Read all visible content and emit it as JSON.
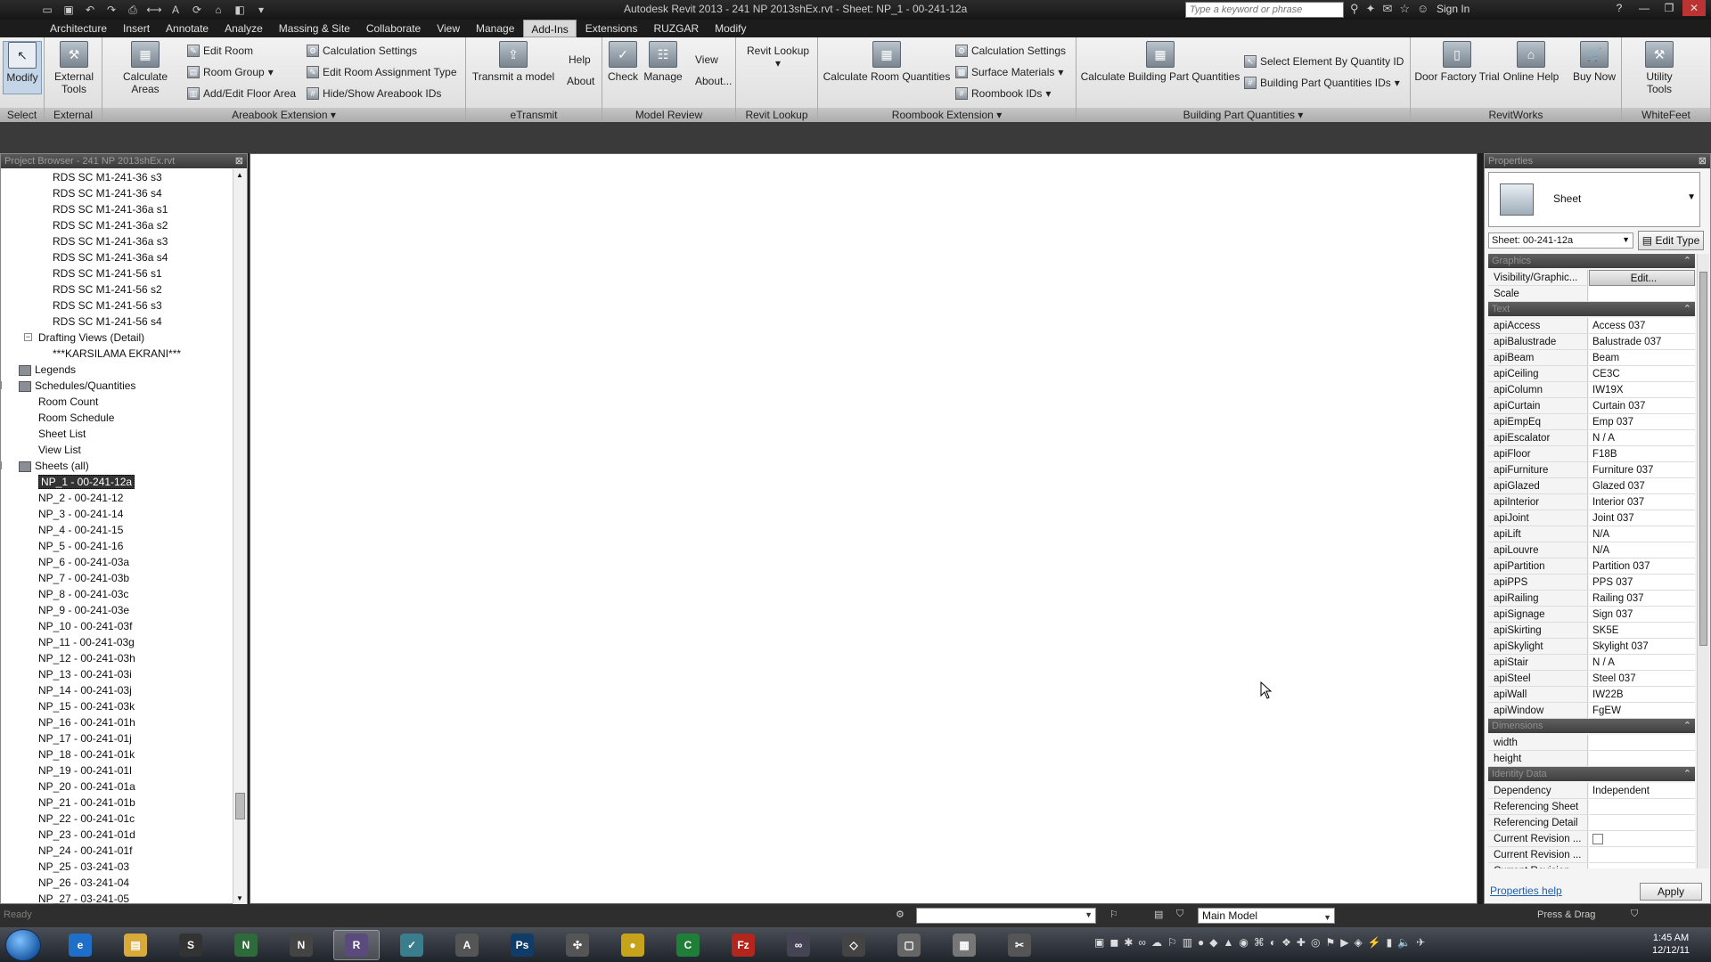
{
  "titlebar": {
    "title": "Autodesk Revit 2013 -  241 NP 2013shEx.rvt - Sheet: NP_1 - 00-241-12a",
    "search_placeholder": "Type a keyword or phrase",
    "sign_in": "Sign In"
  },
  "ribbon_tabs": [
    "Architecture",
    "Insert",
    "Annotate",
    "Analyze",
    "Massing & Site",
    "Collaborate",
    "View",
    "Manage",
    "Add-Ins",
    "Extensions",
    "RUZGAR",
    "Modify"
  ],
  "active_tab_index": 8,
  "ribbon": {
    "select": {
      "title": "Select",
      "modify": "Modify"
    },
    "external": {
      "title": "External",
      "tools": "External Tools"
    },
    "areabook": {
      "title": "Areabook Extension",
      "calculate_areas": "Calculate Areas",
      "edit_room": "Edit Room",
      "room_group": "Room Group",
      "add_edit_floor_area": "Add/Edit Floor Area",
      "calc_settings": "Calculation Settings",
      "edit_room_assign": "Edit Room Assignment Type",
      "hide_show": "Hide/Show Areabook IDs"
    },
    "etransmit": {
      "title": "eTransmit",
      "transmit": "Transmit a model",
      "help": "Help",
      "about": "About"
    },
    "model_review": {
      "title": "Model Review",
      "check": "Check",
      "manage": "Manage",
      "view": "View",
      "about": "About..."
    },
    "revit_lookup": {
      "title": "Revit Lookup",
      "label": "Revit Lookup"
    },
    "roombook": {
      "title": "Roombook Extension",
      "calc_room_qty": "Calculate Room Quantities",
      "calc_settings": "Calculation Settings",
      "surface_materials": "Surface Materials",
      "roombook_ids": "Roombook IDs"
    },
    "building_part": {
      "title": "Building Part Quantities",
      "calc": "Calculate Building Part Quantities",
      "select_by_id": "Select Element By Quantity ID",
      "ids": "Building Part Quantities IDs"
    },
    "revitworks": {
      "title": "RevitWorks",
      "door_factory": "Door Factory Trial",
      "online_help": "Online Help",
      "buy_now": "Buy Now"
    },
    "whitefeet": {
      "title": "WhiteFeet",
      "utility": "Utility Tools"
    }
  },
  "browser": {
    "title": "Project Browser - 241 NP 2013shEx.rvt",
    "items": [
      {
        "label": "RDS SC M1-241-36 s3",
        "indent": 58,
        "type": "leaf"
      },
      {
        "label": "RDS SC M1-241-36 s4",
        "indent": 58,
        "type": "leaf"
      },
      {
        "label": "RDS SC M1-241-36a s1",
        "indent": 58,
        "type": "leaf"
      },
      {
        "label": "RDS SC M1-241-36a s2",
        "indent": 58,
        "type": "leaf"
      },
      {
        "label": "RDS SC M1-241-36a s3",
        "indent": 58,
        "type": "leaf"
      },
      {
        "label": "RDS SC M1-241-36a s4",
        "indent": 58,
        "type": "leaf"
      },
      {
        "label": "RDS SC M1-241-56 s1",
        "indent": 58,
        "type": "leaf"
      },
      {
        "label": "RDS SC M1-241-56 s2",
        "indent": 58,
        "type": "leaf"
      },
      {
        "label": "RDS SC M1-241-56 s3",
        "indent": 58,
        "type": "leaf"
      },
      {
        "label": "RDS SC M1-241-56 s4",
        "indent": 58,
        "type": "leaf"
      },
      {
        "label": "Drafting Views (Detail)",
        "indent": 42,
        "type": "group"
      },
      {
        "label": "***KARSILAMA EKRANI***",
        "indent": 58,
        "type": "leaf"
      },
      {
        "label": "Legends",
        "indent": 38,
        "type": "category"
      },
      {
        "label": "Schedules/Quantities",
        "indent": 38,
        "type": "category-open"
      },
      {
        "label": "Room Count",
        "indent": 42,
        "type": "leaf"
      },
      {
        "label": "Room Schedule",
        "indent": 42,
        "type": "leaf"
      },
      {
        "label": "Sheet List",
        "indent": 42,
        "type": "leaf"
      },
      {
        "label": "View List",
        "indent": 42,
        "type": "leaf"
      },
      {
        "label": "Sheets (all)",
        "indent": 38,
        "type": "category-open"
      },
      {
        "label": "NP_1 - 00-241-12a",
        "indent": 42,
        "type": "leaf",
        "selected": true
      },
      {
        "label": "NP_2 - 00-241-12",
        "indent": 42,
        "type": "leaf"
      },
      {
        "label": "NP_3 - 00-241-14",
        "indent": 42,
        "type": "leaf"
      },
      {
        "label": "NP_4 - 00-241-15",
        "indent": 42,
        "type": "leaf"
      },
      {
        "label": "NP_5 - 00-241-16",
        "indent": 42,
        "type": "leaf"
      },
      {
        "label": "NP_6 - 00-241-03a",
        "indent": 42,
        "type": "leaf"
      },
      {
        "label": "NP_7 - 00-241-03b",
        "indent": 42,
        "type": "leaf"
      },
      {
        "label": "NP_8 - 00-241-03c",
        "indent": 42,
        "type": "leaf"
      },
      {
        "label": "NP_9 - 00-241-03e",
        "indent": 42,
        "type": "leaf"
      },
      {
        "label": "NP_10 - 00-241-03f",
        "indent": 42,
        "type": "leaf"
      },
      {
        "label": "NP_11 - 00-241-03g",
        "indent": 42,
        "type": "leaf"
      },
      {
        "label": "NP_12 - 00-241-03h",
        "indent": 42,
        "type": "leaf"
      },
      {
        "label": "NP_13 - 00-241-03i",
        "indent": 42,
        "type": "leaf"
      },
      {
        "label": "NP_14 - 00-241-03j",
        "indent": 42,
        "type": "leaf"
      },
      {
        "label": "NP_15 - 00-241-03k",
        "indent": 42,
        "type": "leaf"
      },
      {
        "label": "NP_16 - 00-241-01h",
        "indent": 42,
        "type": "leaf"
      },
      {
        "label": "NP_17 - 00-241-01j",
        "indent": 42,
        "type": "leaf"
      },
      {
        "label": "NP_18 - 00-241-01k",
        "indent": 42,
        "type": "leaf"
      },
      {
        "label": "NP_19 - 00-241-01l",
        "indent": 42,
        "type": "leaf"
      },
      {
        "label": "NP_20 - 00-241-01a",
        "indent": 42,
        "type": "leaf"
      },
      {
        "label": "NP_21 - 00-241-01b",
        "indent": 42,
        "type": "leaf"
      },
      {
        "label": "NP_22 - 00-241-01c",
        "indent": 42,
        "type": "leaf"
      },
      {
        "label": "NP_23 - 00-241-01d",
        "indent": 42,
        "type": "leaf"
      },
      {
        "label": "NP_24 - 00-241-01f",
        "indent": 42,
        "type": "leaf"
      },
      {
        "label": "NP_25 - 03-241-03",
        "indent": 42,
        "type": "leaf"
      },
      {
        "label": "NP_26 - 03-241-04",
        "indent": 42,
        "type": "leaf"
      },
      {
        "label": "NP_27 - 03-241-05",
        "indent": 42,
        "type": "leaf"
      }
    ]
  },
  "properties": {
    "title": "Properties",
    "type_name": "Sheet",
    "instance_selector": "Sheet: 00-241-12a",
    "edit_type": "Edit Type",
    "rows": [
      {
        "group": "Graphics"
      },
      {
        "name": "Visibility/Graphic...",
        "value": "Edit...",
        "button": true
      },
      {
        "name": "Scale",
        "value": ""
      },
      {
        "group": "Text"
      },
      {
        "name": "apiAccess",
        "value": "Access 037"
      },
      {
        "name": "apiBalustrade",
        "value": "Balustrade 037"
      },
      {
        "name": "apiBeam",
        "value": "Beam"
      },
      {
        "name": "apiCeiling",
        "value": "CE3C"
      },
      {
        "name": "apiColumn",
        "value": "IW19X"
      },
      {
        "name": "apiCurtain",
        "value": "Curtain 037"
      },
      {
        "name": "apiEmpEq",
        "value": "Emp 037"
      },
      {
        "name": "apiEscalator",
        "value": "N / A"
      },
      {
        "name": "apiFloor",
        "value": "F18B"
      },
      {
        "name": "apiFurniture",
        "value": "Furniture 037"
      },
      {
        "name": "apiGlazed",
        "value": "Glazed 037"
      },
      {
        "name": "apiInterior",
        "value": "Interior 037"
      },
      {
        "name": "apiJoint",
        "value": "Joint 037"
      },
      {
        "name": "apiLift",
        "value": "N/A"
      },
      {
        "name": "apiLouvre",
        "value": "N/A"
      },
      {
        "name": "apiPartition",
        "value": "Partition 037"
      },
      {
        "name": "apiPPS",
        "value": "PPS 037"
      },
      {
        "name": "apiRailing",
        "value": "Railing 037"
      },
      {
        "name": "apiSignage",
        "value": "Sign 037"
      },
      {
        "name": "apiSkirting",
        "value": "SK5E"
      },
      {
        "name": "apiSkylight",
        "value": "Skylight 037"
      },
      {
        "name": "apiStair",
        "value": "N / A"
      },
      {
        "name": "apiSteel",
        "value": "Steel 037"
      },
      {
        "name": "apiWall",
        "value": "IW22B"
      },
      {
        "name": "apiWindow",
        "value": "FgEW"
      },
      {
        "group": "Dimensions"
      },
      {
        "name": "width",
        "value": ""
      },
      {
        "name": "height",
        "value": ""
      },
      {
        "group": "Identity Data"
      },
      {
        "name": "Dependency",
        "value": "Independent"
      },
      {
        "name": "Referencing Sheet",
        "value": ""
      },
      {
        "name": "Referencing Detail",
        "value": ""
      },
      {
        "name": "Current Revision ...",
        "value": "",
        "checkbox": true
      },
      {
        "name": "Current Revision ...",
        "value": ""
      },
      {
        "name": "Current Revision ...",
        "value": ""
      }
    ],
    "help_link": "Properties help",
    "apply": "Apply"
  },
  "statusbar": {
    "text": "Ready",
    "view_combo": "Main Model",
    "press_drag": "Press & Drag"
  },
  "taskbar": {
    "apps": [
      {
        "name": "ie",
        "color": "#1f6fc9",
        "glyph": "e"
      },
      {
        "name": "explorer",
        "color": "#d9a93a",
        "glyph": "▤"
      },
      {
        "name": "steam",
        "color": "#333",
        "glyph": "S"
      },
      {
        "name": "navisworks",
        "color": "#2f6b3a",
        "glyph": "N"
      },
      {
        "name": "navis-manage",
        "color": "#444",
        "glyph": "N"
      },
      {
        "name": "revit",
        "color": "#5b4b7c",
        "glyph": "R"
      },
      {
        "name": "sketch",
        "color": "#3a7d8c",
        "glyph": "✓"
      },
      {
        "name": "autocad",
        "color": "#555",
        "glyph": "A"
      },
      {
        "name": "photoshop",
        "color": "#0f3d68",
        "glyph": "Ps"
      },
      {
        "name": "tool",
        "color": "#555",
        "glyph": "✣"
      },
      {
        "name": "chrome",
        "color": "#c7a21b",
        "glyph": "●"
      },
      {
        "name": "cc",
        "color": "#1f7f38",
        "glyph": "C"
      },
      {
        "name": "filezilla",
        "color": "#b3261e",
        "glyph": "Fz"
      },
      {
        "name": "infinity",
        "color": "#445",
        "glyph": "∞"
      },
      {
        "name": "unity",
        "color": "#444",
        "glyph": "◇"
      },
      {
        "name": "notepad",
        "color": "#666",
        "glyph": "▢"
      },
      {
        "name": "calculator",
        "color": "#777",
        "glyph": "▦"
      },
      {
        "name": "snipping",
        "color": "#555",
        "glyph": "✂"
      }
    ],
    "active_index": 5,
    "time": "1:45 AM",
    "date": "12/12/11"
  }
}
